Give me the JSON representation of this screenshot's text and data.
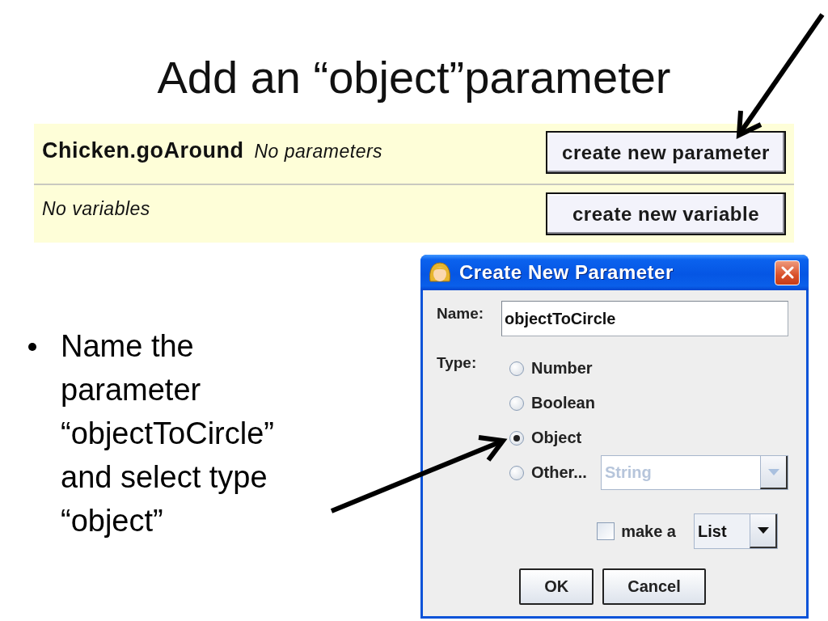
{
  "slide": {
    "title": "Add an “object”parameter"
  },
  "method_panel": {
    "method_name": "Chicken.goAround",
    "parameters_note": "No parameters",
    "parameter_button": "create new parameter",
    "variables_note": "No variables",
    "variable_button": "create new variable"
  },
  "bullets": [
    "Name the parameter “objectToCircle” and select type “object”"
  ],
  "dialog": {
    "title": "Create New Parameter",
    "name_label": "Name:",
    "name_value": "objectToCircle",
    "type_label": "Type:",
    "types": [
      {
        "label": "Number",
        "selected": false
      },
      {
        "label": "Boolean",
        "selected": false
      },
      {
        "label": "Object",
        "selected": true
      },
      {
        "label": "Other...",
        "selected": false,
        "dropdown": {
          "value": "String",
          "disabled": true
        }
      }
    ],
    "make_a": {
      "label": "make a",
      "checked": false
    },
    "collection": {
      "value": "List",
      "disabled": false
    },
    "buttons": [
      "OK",
      "Cancel"
    ]
  }
}
